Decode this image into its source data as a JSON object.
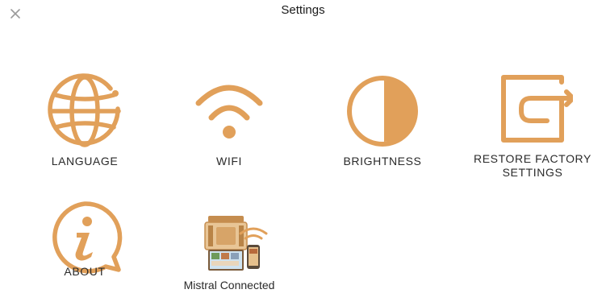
{
  "header": {
    "title": "Settings",
    "close_icon": "close-icon"
  },
  "accent_color": "#e1a05a",
  "tiles": [
    {
      "label": "LANGUAGE",
      "icon": "globe-icon"
    },
    {
      "label": "WIFI",
      "icon": "wifi-icon"
    },
    {
      "label": "BRIGHTNESS",
      "icon": "brightness-icon"
    },
    {
      "label_lines": [
        "RESTORE FACTORY",
        "SETTINGS"
      ],
      "icon": "restore-icon"
    },
    {
      "label": "ABOUT",
      "icon": "info-icon"
    },
    {
      "label": "Mistral Connected",
      "icon": "mistral-connected-icon"
    }
  ]
}
